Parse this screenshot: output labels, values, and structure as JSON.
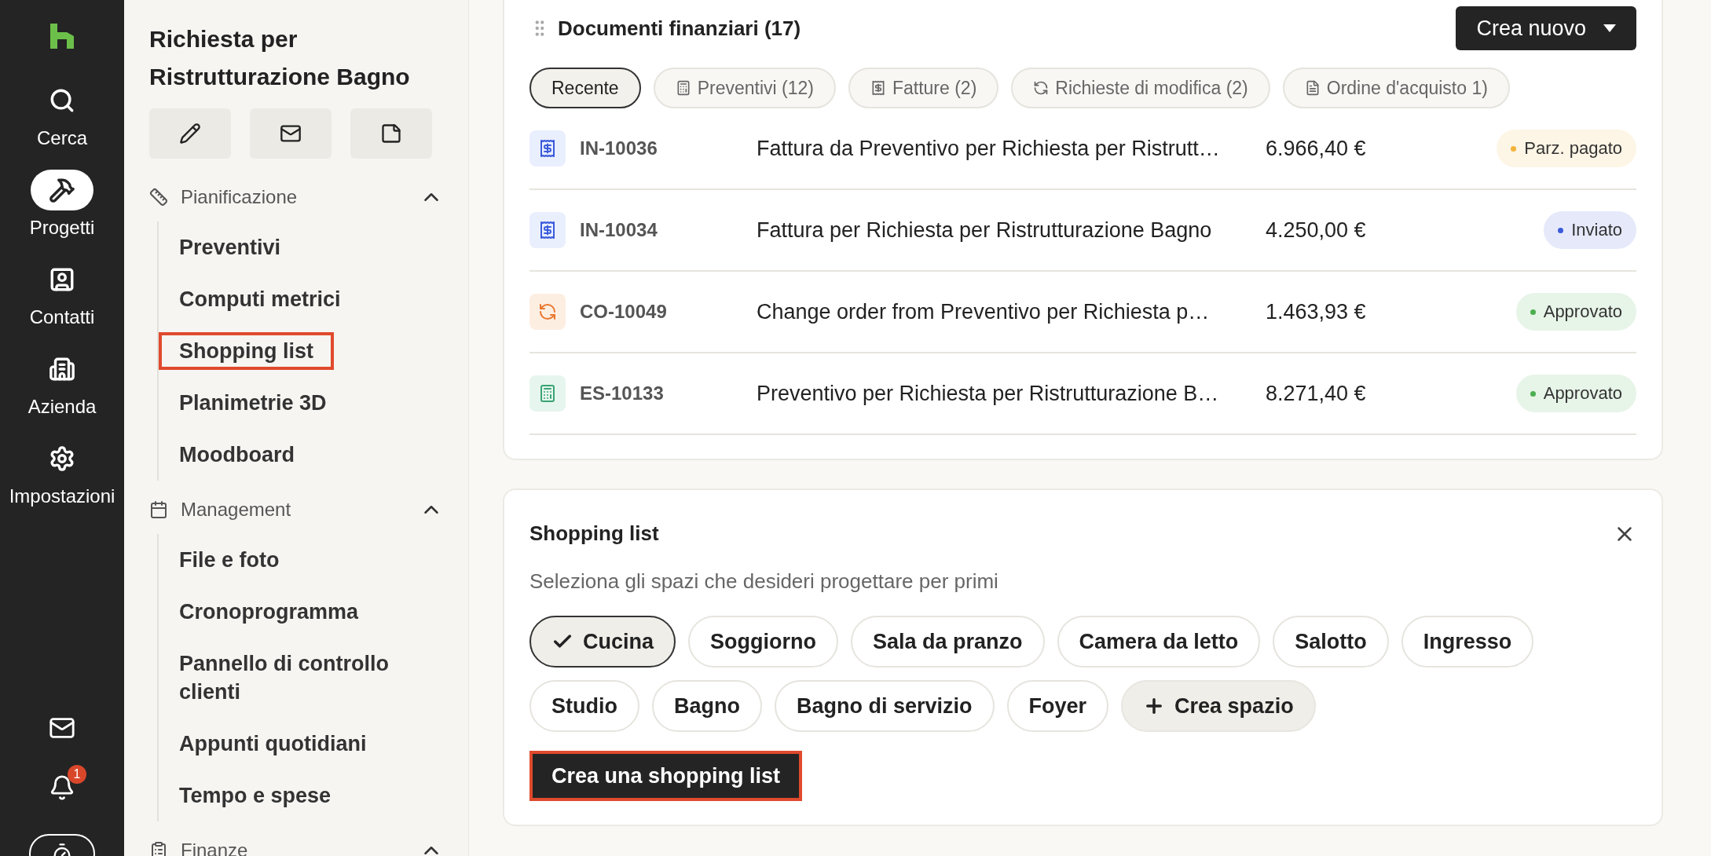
{
  "nav": {
    "items": [
      {
        "kind": "search",
        "label": "Cerca",
        "selected": false
      },
      {
        "kind": "projects",
        "label": "Progetti",
        "selected": true
      },
      {
        "kind": "contacts",
        "label": "Contatti",
        "selected": false
      },
      {
        "kind": "company",
        "label": "Azienda",
        "selected": false
      },
      {
        "kind": "settings",
        "label": "Impostazioni",
        "selected": false
      }
    ],
    "notifications_badge": "1"
  },
  "sidebar": {
    "title": "Richiesta per Ristrutturazione Bagno",
    "actions": [
      {
        "kind": "edit"
      },
      {
        "kind": "mail"
      },
      {
        "kind": "note"
      }
    ],
    "sections": [
      {
        "kind": "planning",
        "label": "Pianificazione",
        "expanded": true,
        "items": [
          {
            "label": "Preventivi",
            "highlighted": false
          },
          {
            "label": "Computi metrici",
            "highlighted": false
          },
          {
            "label": "Shopping list",
            "highlighted": true
          },
          {
            "label": "Planimetrie 3D",
            "highlighted": false
          },
          {
            "label": "Moodboard",
            "highlighted": false
          }
        ]
      },
      {
        "kind": "calendar",
        "label": "Management",
        "expanded": true,
        "items": [
          {
            "label": "File e foto",
            "highlighted": false
          },
          {
            "label": "Cronoprogramma",
            "highlighted": false
          },
          {
            "label": "Pannello di controllo clienti",
            "highlighted": false
          },
          {
            "label": "Appunti quotidiani",
            "highlighted": false
          },
          {
            "label": "Tempo e spese",
            "highlighted": false
          }
        ]
      },
      {
        "kind": "clipboard",
        "label": "Finanze",
        "expanded": true
      }
    ]
  },
  "documents": {
    "title": "Documenti finanziari (17)",
    "create_button": "Crea nuovo",
    "tabs": [
      {
        "kind": "none",
        "label": "Recente",
        "selected": true
      },
      {
        "kind": "estimate",
        "label": "Preventivi (12)",
        "selected": false
      },
      {
        "kind": "invoice",
        "label": "Fatture (2)",
        "selected": false
      },
      {
        "kind": "change",
        "label": "Richieste di modifica (2)",
        "selected": false
      },
      {
        "kind": "order",
        "label": "Ordine d'acquisto 1)",
        "selected": false
      }
    ],
    "rows": [
      {
        "kind": "invoice",
        "number": "IN-10036",
        "description": "Fattura da Preventivo per Richiesta per Ristrutt…",
        "amount": "6.966,40 €",
        "status": {
          "label": "Parz. pagato",
          "color": "#f2b33d"
        }
      },
      {
        "kind": "invoice",
        "number": "IN-10034",
        "description": "Fattura per Richiesta per Ristrutturazione Bagno",
        "amount": "4.250,00 €",
        "status": {
          "label": "Inviato",
          "color": "#3b5bdb"
        }
      },
      {
        "kind": "change",
        "number": "CO-10049",
        "description": "Change order from Preventivo per Richiesta p…",
        "amount": "1.463,93 €",
        "status": {
          "label": "Approvato",
          "color": "#4caf50"
        }
      },
      {
        "kind": "estimate",
        "number": "ES-10133",
        "description": "Preventivo per Richiesta per Ristrutturazione B…",
        "amount": "8.271,40 €",
        "status": {
          "label": "Approvato",
          "color": "#4caf50"
        }
      }
    ]
  },
  "shopping": {
    "title": "Shopping list",
    "subtitle": "Seleziona gli spazi che desideri progettare per primi",
    "spaces": [
      {
        "kind": "space",
        "label": "Cucina",
        "selected": true
      },
      {
        "kind": "space",
        "label": "Soggiorno",
        "selected": false
      },
      {
        "kind": "space",
        "label": "Sala da pranzo",
        "selected": false
      },
      {
        "kind": "space",
        "label": "Camera da letto",
        "selected": false
      },
      {
        "kind": "space",
        "label": "Salotto",
        "selected": false
      },
      {
        "kind": "space",
        "label": "Ingresso",
        "selected": false
      },
      {
        "kind": "space",
        "label": "Studio",
        "selected": false
      },
      {
        "kind": "space",
        "label": "Bagno",
        "selected": false
      },
      {
        "kind": "space",
        "label": "Bagno di servizio",
        "selected": false
      },
      {
        "kind": "space",
        "label": "Foyer",
        "selected": false
      },
      {
        "kind": "add",
        "label": "Crea spazio",
        "selected": false
      }
    ],
    "button": {
      "label": "Crea una shopping list",
      "highlighted": true
    }
  }
}
